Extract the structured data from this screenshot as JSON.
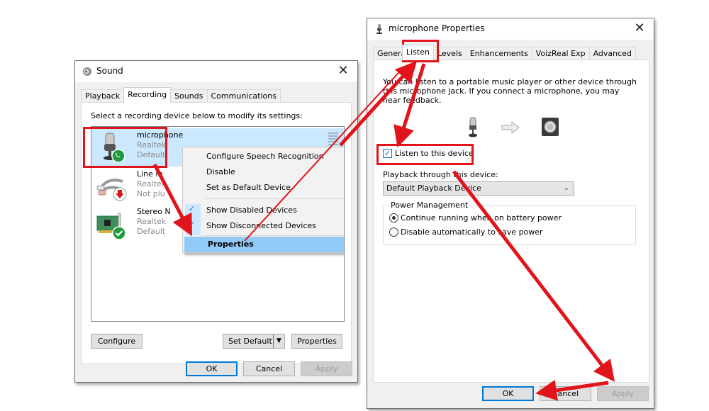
{
  "sound_dialog": {
    "title": "Sound",
    "tabs": [
      {
        "label": "Playback",
        "active": false
      },
      {
        "label": "Recording",
        "active": true
      },
      {
        "label": "Sounds",
        "active": false
      },
      {
        "label": "Communications",
        "active": false
      }
    ],
    "instruction": "Select a recording device below to modify its settings:",
    "devices": [
      {
        "name": "microphone",
        "line1": "Realtek",
        "line2": "Default",
        "icon": "microphone-icon",
        "status": "default-communications",
        "selected": true
      },
      {
        "name": "Line in",
        "line1": "Realtek",
        "line2": "Not plu",
        "icon": "rca-cable-icon",
        "status": "not-plugged",
        "selected": false
      },
      {
        "name": "Stereo N",
        "line1": "Realtek",
        "line2": "Default",
        "icon": "sound-card-icon",
        "status": "default",
        "selected": false
      }
    ],
    "context_menu": {
      "items": [
        {
          "label": "Configure Speech Recognition",
          "checked": false,
          "highlighted": false
        },
        {
          "label": "Disable",
          "checked": false,
          "highlighted": false
        },
        {
          "label": "Set as Default Device",
          "checked": false,
          "highlighted": false
        },
        {
          "label": "Show Disabled Devices",
          "checked": true,
          "highlighted": false
        },
        {
          "label": "Show Disconnected Devices",
          "checked": true,
          "highlighted": false
        },
        {
          "label": "Properties",
          "checked": false,
          "highlighted": true
        }
      ]
    },
    "buttons": {
      "configure": "Configure",
      "set_default": "Set Default",
      "properties": "Properties",
      "ok": "OK",
      "cancel": "Cancel",
      "apply": "Apply"
    }
  },
  "properties_dialog": {
    "title": "microphone Properties",
    "tabs": [
      {
        "label": "General",
        "active": false
      },
      {
        "label": "Listen",
        "active": true
      },
      {
        "label": "Levels",
        "active": false
      },
      {
        "label": "Enhancements",
        "active": false
      },
      {
        "label": "VoizReal Exp",
        "active": false
      },
      {
        "label": "Advanced",
        "active": false
      }
    ],
    "description": "You can listen to a portable music player or other device through this microphone jack.  If you connect a microphone, you may hear feedback.",
    "listen_checkbox": {
      "label": "Listen to this device",
      "checked": true
    },
    "playback_label": "Playback through this device:",
    "playback_select": {
      "value": "Default Playback Device"
    },
    "power_management": {
      "label": "Power Management",
      "options": [
        {
          "label": "Continue running when on battery power",
          "selected": true
        },
        {
          "label": "Disable automatically to save power",
          "selected": false
        }
      ]
    },
    "buttons": {
      "ok": "OK",
      "cancel": "Cancel",
      "apply": "Apply"
    }
  },
  "annotations": {
    "highlight_color": "#e1141b",
    "accent_color": "#0078d7"
  }
}
